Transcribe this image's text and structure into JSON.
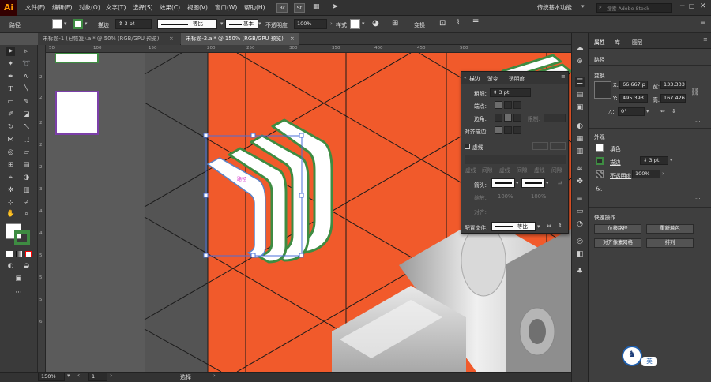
{
  "app": {
    "logo": "Ai"
  },
  "menu": [
    "文件(F)",
    "编辑(E)",
    "对象(O)",
    "文字(T)",
    "选择(S)",
    "效果(C)",
    "视图(V)",
    "窗口(W)",
    "帮助(H)"
  ],
  "bridge_buttons": [
    "Br",
    "St"
  ],
  "workspace": "传统基本功能",
  "search_placeholder": "搜索 Adobe Stock",
  "control": {
    "selection_label": "路径",
    "stroke_label": "描边",
    "stroke_value": "3 pt",
    "profile_label": "等比",
    "brush_label": "基本",
    "opacity_label": "不透明度",
    "opacity_value": "100%",
    "style_label": "样式",
    "transform_label": "变换"
  },
  "tabs": [
    {
      "label": "未标题-1 (已恢复).ai* @ 50% (RGB/GPU 预览)",
      "active": false
    },
    {
      "label": "未标题-2.ai* @ 150% (RGB/GPU 预览)",
      "active": true
    }
  ],
  "rulers": {
    "h": [
      "50",
      "100",
      "150",
      "200",
      "250",
      "300",
      "350",
      "400",
      "450",
      "500"
    ],
    "v": [
      "2",
      "2",
      "2",
      "2",
      "2",
      "3",
      "4",
      "4",
      "5",
      "5",
      "5",
      "6"
    ]
  },
  "canvas": {
    "path_label": "路径",
    "colors": {
      "orange": "#F15A2B",
      "pasteboard": "#5B5B5B",
      "artboard_left": "#545454",
      "stroke_green": "#3E8C42",
      "selection_blue": "#4A6FD8",
      "swatch_purple": "#7B3FA8"
    }
  },
  "status": {
    "zoom": "150%",
    "page": "1",
    "tool": "选择"
  },
  "stroke_panel": {
    "tabs": [
      "描边",
      "渐变",
      "透明度"
    ],
    "weight_label": "粗细:",
    "weight_value": "3 pt",
    "cap_label": "端点:",
    "corner_label": "边角:",
    "miter_label": "限制:",
    "align_label": "对齐描边:",
    "dashed_label": "虚线",
    "dash_labels": [
      "虚线",
      "间隙",
      "虚线",
      "间隙",
      "虚线",
      "间隙"
    ],
    "arrow_label": "箭头:",
    "scale_label": "缩放:",
    "scale_values": [
      "100%",
      "100%"
    ],
    "align_arrow_label": "对齐:",
    "profile_label": "配置文件:",
    "profile_value": "等比"
  },
  "properties": {
    "tabs": [
      "属性",
      "库",
      "图层"
    ],
    "section_path": "路径",
    "transform_title": "变换",
    "x_label": "X:",
    "x_value": "66.667 p",
    "y_label": "Y:",
    "y_value": "495.393",
    "w_label": "宽:",
    "w_value": "133.333",
    "h_label": "高:",
    "h_value": "167.426",
    "angle_label": "△:",
    "angle_value": "0°",
    "appearance_title": "外观",
    "fill_label": "填色",
    "stroke_label": "描边",
    "stroke_value": "3 pt",
    "opacity_label": "不透明度",
    "opacity_value": "100%",
    "fx_label": "fx.",
    "quick_actions_title": "快速操作",
    "buttons": [
      "位移路径",
      "重新着色",
      "对齐像素网格",
      "排列"
    ]
  },
  "ime": {
    "label": "英"
  }
}
